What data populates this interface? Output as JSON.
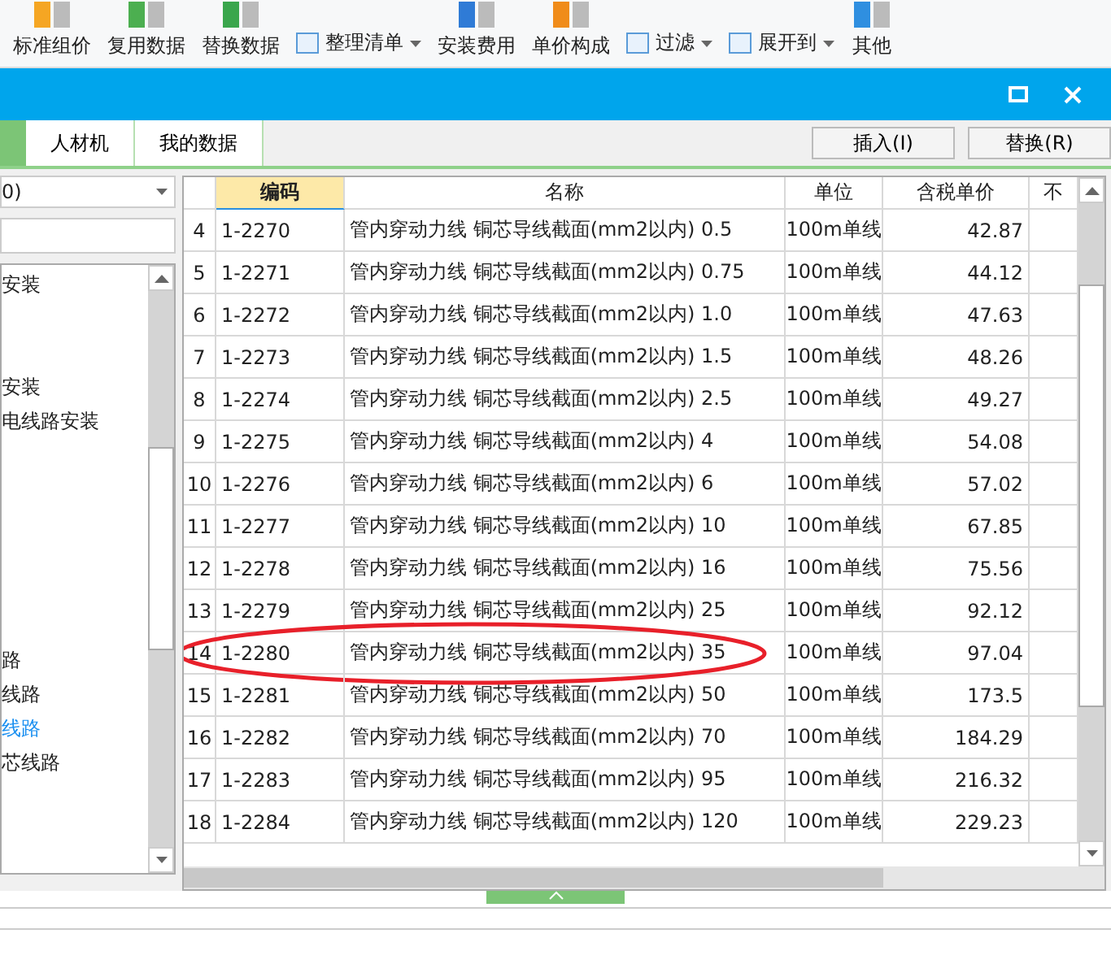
{
  "toolbar": {
    "items": [
      {
        "label": "标准组价",
        "kind": "big"
      },
      {
        "label": "复用数据",
        "kind": "big"
      },
      {
        "label": "替换数据",
        "kind": "big"
      },
      {
        "label": "整理清单",
        "kind": "small",
        "dropdown": true
      },
      {
        "label": "安装费用",
        "kind": "big"
      },
      {
        "label": "单价构成",
        "kind": "big"
      },
      {
        "label": "过滤",
        "kind": "small",
        "dropdown": true
      },
      {
        "label": "展开到",
        "kind": "small",
        "dropdown": true
      },
      {
        "label": "其他",
        "kind": "big"
      }
    ]
  },
  "dialog": {
    "cut_tab": {
      "selected": true
    },
    "tabs": [
      {
        "label": "人材机",
        "selected": false
      },
      {
        "label": "我的数据",
        "selected": false
      }
    ],
    "buttons": [
      "插入(I)",
      "替换(R)"
    ]
  },
  "left_panel": {
    "dropdown_value": "0)",
    "tree": [
      {
        "label": "安装",
        "selected": false
      },
      {
        "label": "安装",
        "selected": false
      },
      {
        "label": "电线路安装",
        "selected": false
      },
      {
        "label": "路",
        "selected": false
      },
      {
        "label": "线路",
        "selected": false
      },
      {
        "label": "线路",
        "selected": true
      },
      {
        "label": "芯线路",
        "selected": false
      }
    ]
  },
  "table": {
    "columns": [
      {
        "label": "编码",
        "selected": true
      },
      {
        "label": "名称",
        "selected": false
      },
      {
        "label": "单位",
        "selected": false
      },
      {
        "label": "含税单价",
        "selected": false
      },
      {
        "label": "不",
        "selected": false
      }
    ],
    "rows": [
      {
        "no": "4",
        "code": "1-2270",
        "name": "管内穿动力线 铜芯导线截面(mm2以内) 0.5",
        "unit": "100m单线",
        "price": "42.87",
        "circled": false
      },
      {
        "no": "5",
        "code": "1-2271",
        "name": "管内穿动力线 铜芯导线截面(mm2以内) 0.75",
        "unit": "100m单线",
        "price": "44.12",
        "circled": false
      },
      {
        "no": "6",
        "code": "1-2272",
        "name": "管内穿动力线 铜芯导线截面(mm2以内) 1.0",
        "unit": "100m单线",
        "price": "47.63",
        "circled": false
      },
      {
        "no": "7",
        "code": "1-2273",
        "name": "管内穿动力线 铜芯导线截面(mm2以内) 1.5",
        "unit": "100m单线",
        "price": "48.26",
        "circled": false
      },
      {
        "no": "8",
        "code": "1-2274",
        "name": "管内穿动力线 铜芯导线截面(mm2以内) 2.5",
        "unit": "100m单线",
        "price": "49.27",
        "circled": false
      },
      {
        "no": "9",
        "code": "1-2275",
        "name": "管内穿动力线 铜芯导线截面(mm2以内) 4",
        "unit": "100m单线",
        "price": "54.08",
        "circled": false
      },
      {
        "no": "10",
        "code": "1-2276",
        "name": "管内穿动力线 铜芯导线截面(mm2以内) 6",
        "unit": "100m单线",
        "price": "57.02",
        "circled": false
      },
      {
        "no": "11",
        "code": "1-2277",
        "name": "管内穿动力线 铜芯导线截面(mm2以内) 10",
        "unit": "100m单线",
        "price": "67.85",
        "circled": false
      },
      {
        "no": "12",
        "code": "1-2278",
        "name": "管内穿动力线 铜芯导线截面(mm2以内) 16",
        "unit": "100m单线",
        "price": "75.56",
        "circled": false
      },
      {
        "no": "13",
        "code": "1-2279",
        "name": "管内穿动力线 铜芯导线截面(mm2以内) 25",
        "unit": "100m单线",
        "price": "92.12",
        "circled": false
      },
      {
        "no": "14",
        "code": "1-2280",
        "name": "管内穿动力线 铜芯导线截面(mm2以内) 35",
        "unit": "100m单线",
        "price": "97.04",
        "circled": true
      },
      {
        "no": "15",
        "code": "1-2281",
        "name": "管内穿动力线 铜芯导线截面(mm2以内) 50",
        "unit": "100m单线",
        "price": "173.5",
        "circled": false
      },
      {
        "no": "16",
        "code": "1-2282",
        "name": "管内穿动力线 铜芯导线截面(mm2以内) 70",
        "unit": "100m单线",
        "price": "184.29",
        "circled": false
      },
      {
        "no": "17",
        "code": "1-2283",
        "name": "管内穿动力线 铜芯导线截面(mm2以内) 95",
        "unit": "100m单线",
        "price": "216.32",
        "circled": false
      },
      {
        "no": "18",
        "code": "1-2284",
        "name": "管内穿动力线 铜芯导线截面(mm2以内) 120",
        "unit": "100m单线",
        "price": "229.23",
        "circled": false
      }
    ]
  }
}
